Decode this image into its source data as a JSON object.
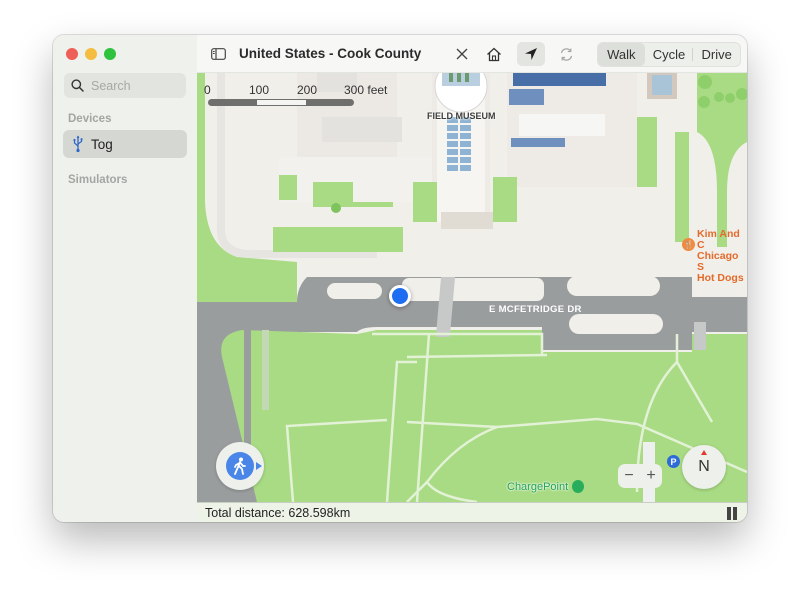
{
  "window": {
    "traffic_lights": [
      "close",
      "minimize",
      "zoom"
    ]
  },
  "sidebar": {
    "search": {
      "placeholder": "Search",
      "value": "",
      "icon": "search-icon"
    },
    "sections": [
      {
        "label": "Devices",
        "items": [
          {
            "label": "Tog",
            "icon": "usb-icon",
            "selected": true
          }
        ]
      },
      {
        "label": "Simulators",
        "items": []
      }
    ]
  },
  "toolbar": {
    "sidebar_toggle_icon": "sidebar-icon",
    "title": "United States - Cook County",
    "close_icon": "close-icon",
    "home_icon": "home-icon",
    "location_icon": "location-arrow-icon",
    "refresh_icon": "refresh-icon",
    "modes": [
      "Walk",
      "Cycle",
      "Drive"
    ],
    "selected_mode": "Walk"
  },
  "map": {
    "scale": {
      "labels": [
        "0",
        "100",
        "200",
        "300 feet"
      ]
    },
    "labels": {
      "museum": "FIELD MUSEUM",
      "restaurant": [
        "Kim And C",
        "Chicago S",
        "Hot Dogs"
      ],
      "street": "E MCFETRIDGE DR",
      "charging": "ChargePoint"
    },
    "controls": {
      "walk_icon": "walking-person-icon",
      "zoom_out": "−",
      "zoom_in": "+",
      "compass": "N",
      "parking": "P"
    },
    "colors": {
      "park": "#a9dc85",
      "road": "#9a9d9e",
      "location": "#1f6ef2",
      "poi_food": "#e46a2c",
      "poi_charge": "#24a35a"
    }
  },
  "status": {
    "total_distance": "Total distance: 628.598km",
    "pause_icon": "pause-icon"
  }
}
